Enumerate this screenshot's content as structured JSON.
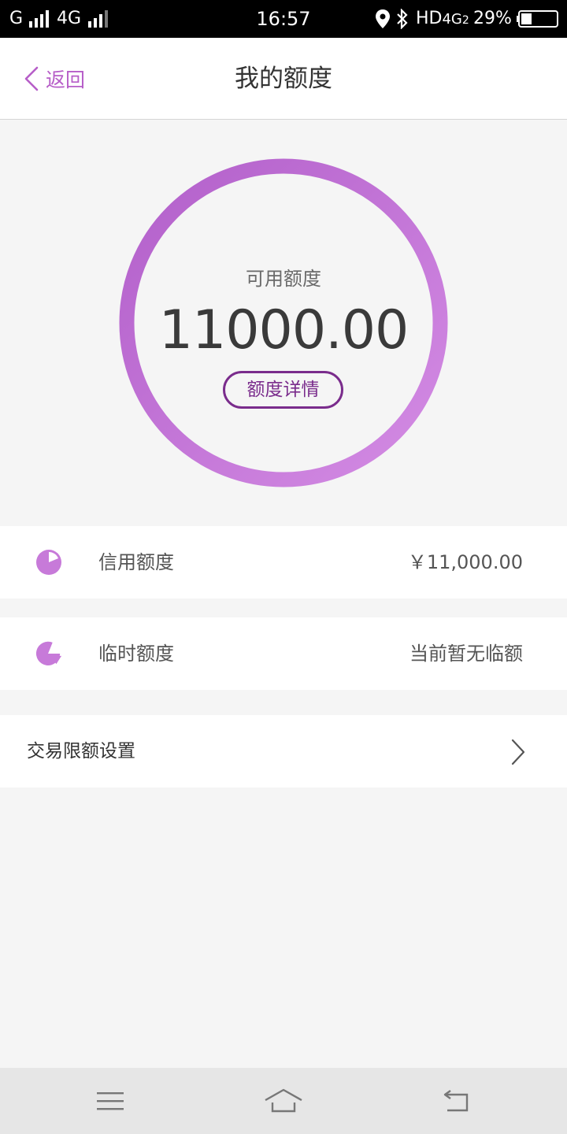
{
  "status_bar": {
    "carrier1": "G",
    "network1": "4G",
    "time": "16:57",
    "hd": "HD",
    "network2": "4G",
    "battery": "29%"
  },
  "header": {
    "back_label": "返回",
    "title": "我的额度"
  },
  "summary": {
    "label": "可用额度",
    "amount": "11000.00",
    "detail_button": "额度详情"
  },
  "rows": [
    {
      "icon": "pie-chart-icon",
      "label": "信用额度",
      "value": "￥11,000.00"
    },
    {
      "icon": "pie-split-icon",
      "label": "临时额度",
      "value": "当前暂无临额"
    }
  ],
  "settings": {
    "label": "交易限额设置"
  },
  "colors": {
    "accent": "#b75ec8",
    "ring_start": "#b562cc",
    "ring_end": "#d08ae3",
    "button": "#7a2c8c"
  }
}
